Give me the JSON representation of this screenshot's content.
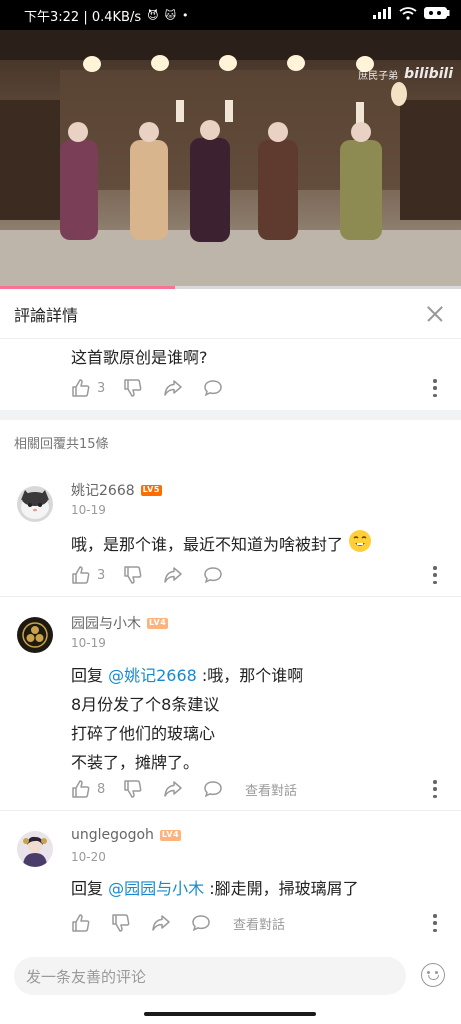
{
  "status_bar": {
    "time_speed": "下午3:22 | 0.4KB/s",
    "icons": [
      "devil-icon",
      "cat-icon",
      "dot-icon"
    ],
    "right_icons": [
      "signal-icon",
      "wifi-icon",
      "battery-icon"
    ]
  },
  "video": {
    "watermark_channel": "庶民子弟",
    "watermark_logo": "bilibili",
    "progress": 0.38
  },
  "detail": {
    "title": "評論詳情"
  },
  "root_comment": {
    "text": "这首歌原创是谁啊?",
    "likes": "3"
  },
  "related_label": "相關回覆共15條",
  "replies": [
    {
      "username": "姚记2668",
      "level": "LV5",
      "date": "10-19",
      "lines": [
        "哦，是那个谁，最近不知道为啥被封了"
      ],
      "likes": "3",
      "view_convo": ""
    },
    {
      "username": "园园与小木",
      "level": "LV4",
      "date": "10-19",
      "reply_prefix": "回复 ",
      "mention": "@姚记2668",
      "first_line_rest": " :哦，那个谁啊",
      "lines": [
        "8月份发了个8条建议",
        "打碎了他们的玻璃心",
        "不装了，摊牌了。"
      ],
      "likes": "8",
      "view_convo": "查看對話"
    },
    {
      "username": "unglegogoh",
      "level": "LV4",
      "date": "10-20",
      "reply_prefix": "回复 ",
      "mention": "@园园与小木",
      "first_line_rest": " :腳走開，掃玻璃屑了",
      "likes": "",
      "view_convo": "查看對話"
    }
  ],
  "bottom_bar": {
    "input_placeholder": "发一条友善的评论"
  },
  "colors": {
    "accent_pink": "#fb7299",
    "mention_blue": "#178bcf",
    "lv5": "#ff6c00",
    "lv4": "#ffb37c"
  }
}
